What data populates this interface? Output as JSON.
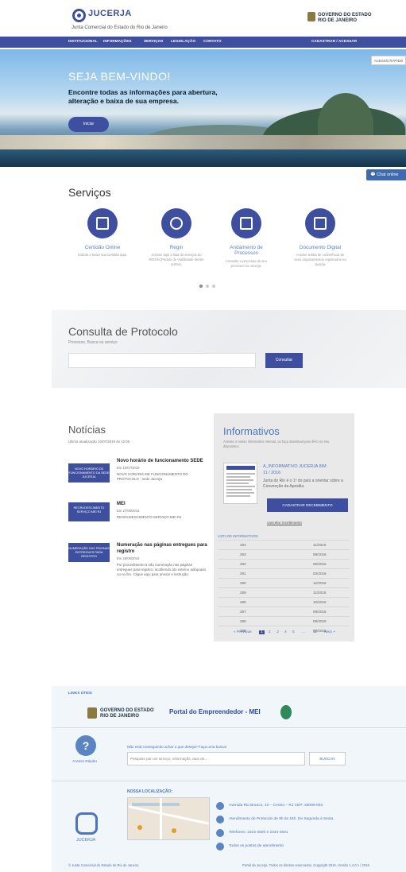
{
  "header": {
    "brand": "JUCERJA",
    "subtitle": "Junta Comercial do Estado do Rio de Janeiro",
    "gov_logo_text": "GOVERNO DO ESTADO\nRIO DE JANEIRO"
  },
  "nav": {
    "items": [
      "INSTITUCIONAL",
      "INFORMAÇÕES",
      "SERVIÇOS",
      "LEGISLAÇÃO",
      "CONTATO"
    ],
    "account": "CADASTRAR / ACESSAR"
  },
  "hero": {
    "title": "SEJA BEM-VINDO!",
    "subtitle": "Encontre todas as informações para abertura, alteração e baixa de sua empresa.",
    "button": "Iniciar",
    "quick_access": "ACESSO RÁPIDO",
    "chat": "Chat online"
  },
  "services": {
    "title": "Serviços",
    "items": [
      {
        "title": "Certidão Online",
        "desc": "Solicite e baixe sua certidão aqui."
      },
      {
        "title": "Regin",
        "desc": "Acesse aqui a lista de serviços do REGIN (Pedido de Viabilidade dentre outros)."
      },
      {
        "title": "Andamento de Processos",
        "desc": "Consulte o processo de seu processo na Jucerja."
      },
      {
        "title": "Documento Digital",
        "desc": "Acesse a lista de conferência de seus arquivamentos registrados na Jucerja."
      }
    ]
  },
  "consulta": {
    "title": "Consulta de Protocolo",
    "subtitle": "Processo, Busca ou serviço",
    "button": "Consultar"
  },
  "news": {
    "title": "Notícias",
    "updated": "Última atualização 10/07/2019 às 12:05",
    "items": [
      {
        "thumb": "NOVO HORÁRIO DE FUNCIONAMENTO DA SEDE JUCERJA",
        "title": "Novo horário de funcionamento SEDE",
        "date": "Em 10/07/2019",
        "text": "NOVO HORÁRIO DE FUNCIONAMENTO DO PROTOCOLO - sede Jucerja"
      },
      {
        "thumb": "RECRUDESCIMENTO SERVIÇO MEI RJ",
        "title": "MEI",
        "date": "Em 27/06/2016",
        "text": "RECRUDESCIMENTO SERVIÇO MEI RJ"
      },
      {
        "thumb": "NUMERAÇÃO DAS PÁGINAS ENTREGUES PARA REGISTRO",
        "title": "Numeração nas páginas entregues para registro",
        "date": "Em 29/06/2016",
        "text": "Por procedimento a não numeração nas páginas entregues para registro, acolhendo ato externo adequado ou no fim. Clique aqui para anexar e instrução."
      }
    ]
  },
  "informativos": {
    "title": "Informativos",
    "desc": "Acesse o nosso informativo mensal, ou faça download para lê-lo no seu dispositivo.",
    "headline": "A_INFORMATIVO JUCERJA 8/M",
    "date": "11 / 2016",
    "paragraph": "Junta do Rio é o 1º do país a orientar sobre a Convenção da Apostila.",
    "button": "CADASTRAR RECEBIMENTO",
    "link": "cancelar recebimento",
    "list_label": "LISTA DE INFORMATIVOS",
    "list": [
      [
        "294",
        "11/2016"
      ],
      [
        "293",
        "08/2016"
      ],
      [
        "292",
        "05/2016"
      ],
      [
        "291",
        "02/2016"
      ],
      [
        "290",
        "12/2015"
      ],
      [
        "289",
        "11/2015"
      ],
      [
        "288",
        "10/2015"
      ],
      [
        "287",
        "09/2015"
      ],
      [
        "286",
        "08/2015"
      ],
      [
        "285",
        "07/2015"
      ]
    ],
    "pager": [
      "« Previous",
      "1",
      "2",
      "3",
      "4",
      "5",
      "...",
      "10",
      "Next »"
    ]
  },
  "footer": {
    "links_label": "LINKS ÚTEIS",
    "link2": "Portal do Empreendedor - MEI",
    "quick_label": "Acesso Rápido",
    "search_text": "Não está conseguindo achar o que deseja? Faça uma busca!",
    "search_placeholder": "Pesquise por um serviço, informação, atos de...",
    "search_btn": "BUSCAR",
    "jucerja_label": "JUCERJA",
    "location_label": "NOSSA LOCALIZAÇÃO:",
    "address": "Avenida Rio Branco, 10 – Centro – RJ CEP: 20090-003",
    "hours": "Atendimento do Protocolo de 9h às 16h. De Segunda à Sexta.",
    "phone": "Telefones: 2334-4500 e 2334-4501",
    "points": "Todos os postos de atendimento",
    "copyright_left": "© Junta Comercial do Estado do Rio de Janeiro",
    "copyright_right": "Portal da Jucerja. Todos os direitos reservados. Copyright 2016. Versão 1.4.0.1 / 2016"
  }
}
